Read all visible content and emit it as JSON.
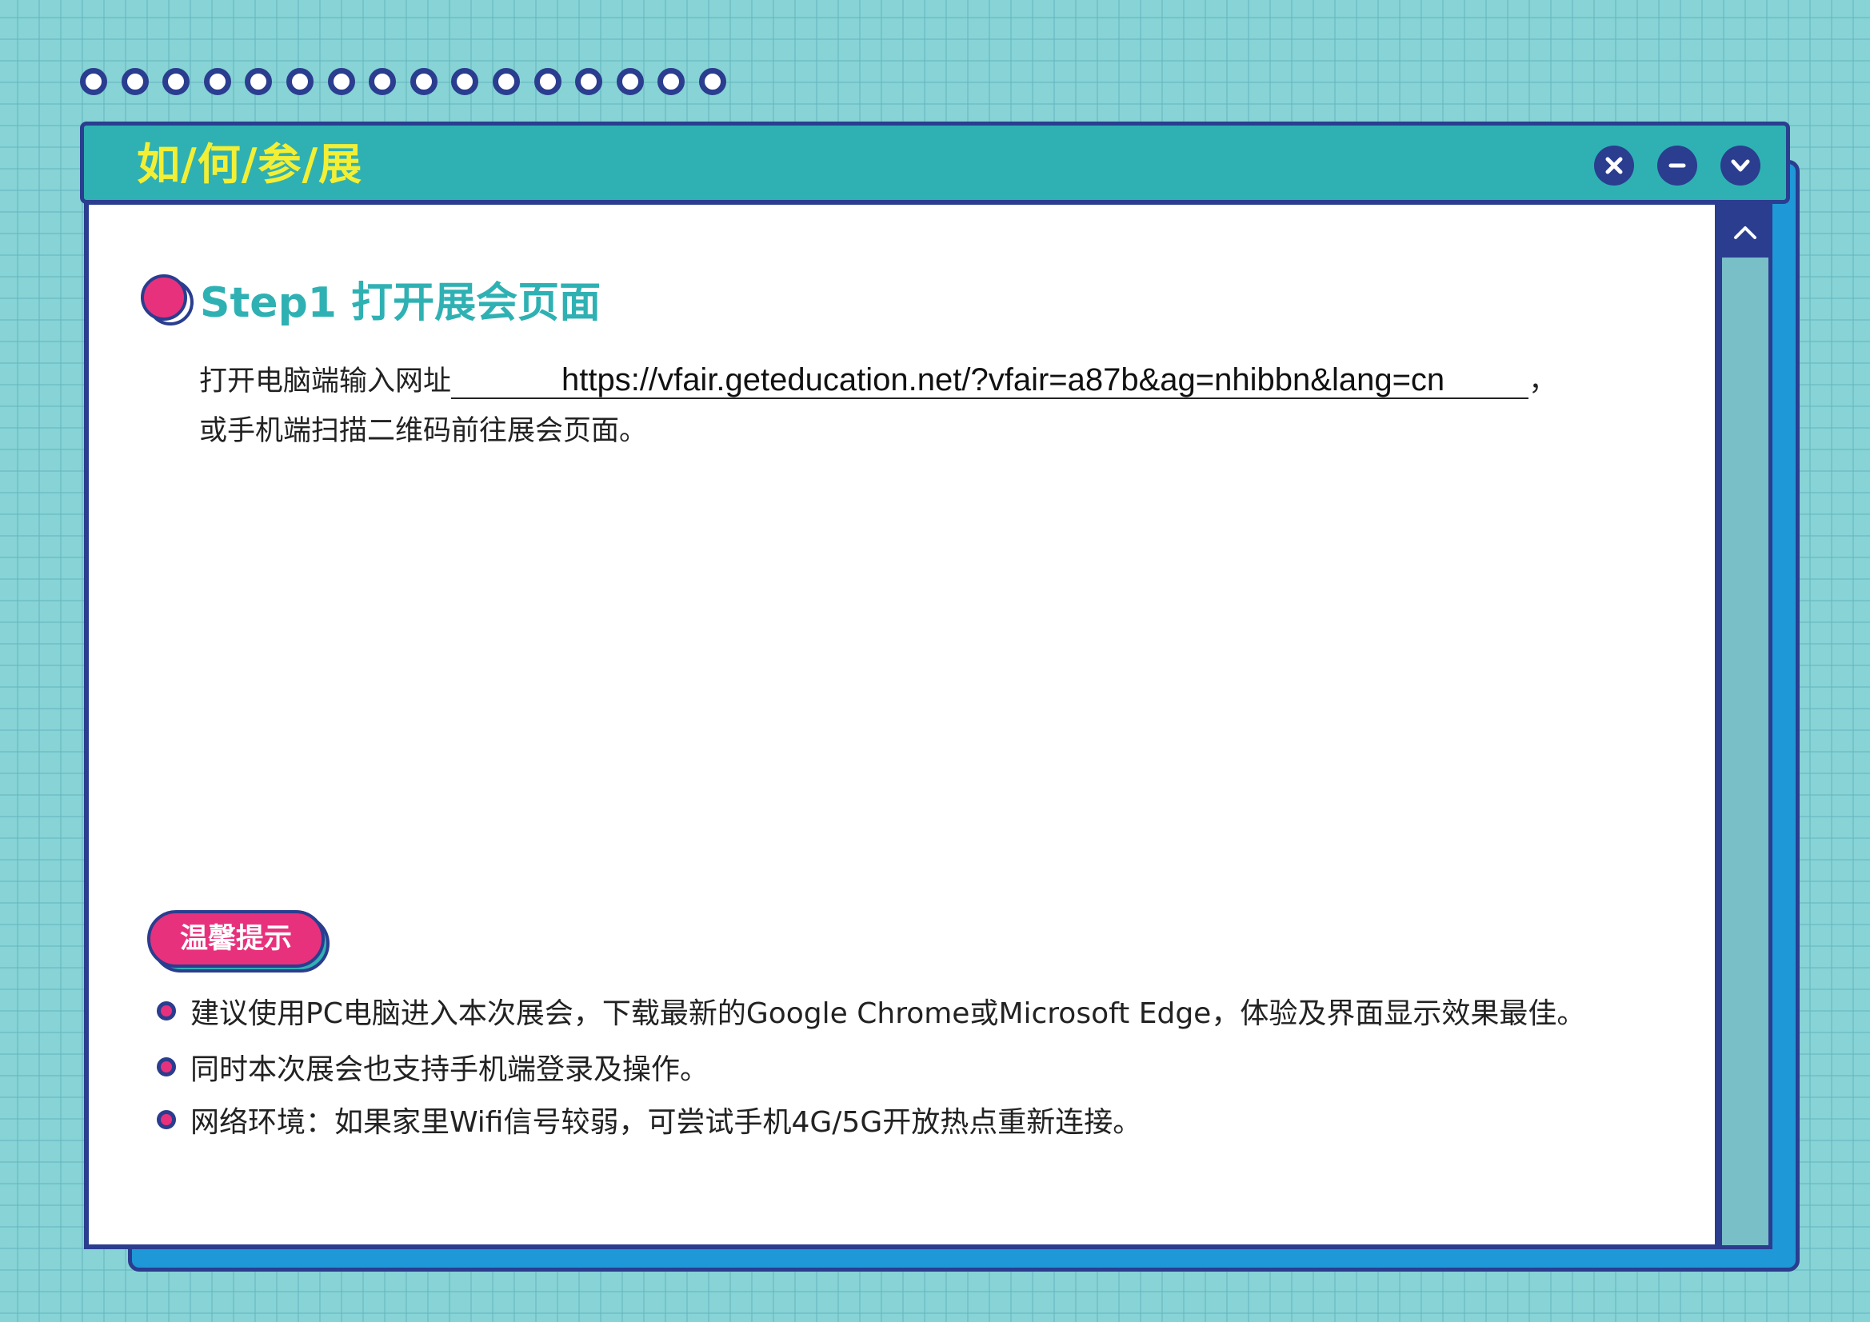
{
  "window": {
    "title": "如/何/参/展"
  },
  "controls": {
    "close_icon": "close-icon",
    "minimize_icon": "minimize-icon",
    "collapse_icon": "chevron-down-icon",
    "scroll_up_icon": "chevron-up-icon"
  },
  "step": {
    "title": "Step1 打开展会页面",
    "line1_prefix": "打开电脑端输入网址",
    "url": "https://vfair.geteducation.net/?vfair=a87b&ag=nhibbn&lang=cn",
    "line1_suffix": "，",
    "line2": "或手机端扫描二维码前往展会页面。"
  },
  "tips": {
    "badge_label": "温馨提示",
    "items": [
      "建议使用PC电脑进入本次展会，下载最新的Google Chrome或Microsoft Edge，体验及界面显示效果最佳。",
      "同时本次展会也支持手机端登录及操作。",
      "网络环境：如果家里Wifi信号较弱，可尝试手机4G/5G开放热点重新连接。"
    ]
  },
  "colors": {
    "background": "#87d3d5",
    "titlebar": "#2fb1b3",
    "border": "#2a3d8f",
    "title_text": "#f3ef35",
    "accent_pink": "#e8317c",
    "accent_blue": "#1f98d8",
    "scrollbar_track": "#79bfc8"
  },
  "decoration": {
    "dot_count": 16
  }
}
